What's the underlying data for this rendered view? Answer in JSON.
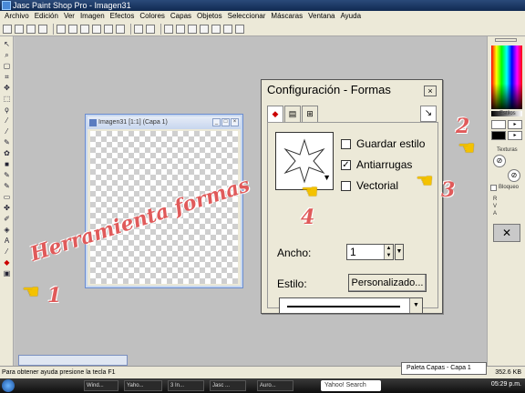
{
  "window": {
    "title": "Jasc Paint Shop Pro - Imagen31"
  },
  "menu": [
    "Archivo",
    "Edición",
    "Ver",
    "Imagen",
    "Efectos",
    "Colores",
    "Capas",
    "Objetos",
    "Seleccionar",
    "Máscaras",
    "Ventana",
    "Ayuda"
  ],
  "image_window": {
    "title": "Imagen31 [1:1] (Capa 1)"
  },
  "dialog": {
    "title": "Configuración - Formas",
    "close": "×",
    "guardar_estilo": "Guardar estilo",
    "antiarrugas": "Antiarrugas",
    "vectorial": "Vectorial",
    "ancho_label": "Ancho:",
    "ancho_value": "1",
    "estilo_label": "Estilo:",
    "personalizado": "Personalizado..."
  },
  "right_panel": {
    "estilos": "Estilos",
    "texturas": "Texturas",
    "bloqueo": "Bloqueo",
    "r": "R",
    "v": "V",
    "a": "A"
  },
  "annotation": {
    "text": "Herramienta formas",
    "n1": "1",
    "n2": "2",
    "n3": "3",
    "n4": "4"
  },
  "status": {
    "help": "Para obtener ayuda presione la tecla F1",
    "size": "352.6 KB"
  },
  "layers_tip": "Paleta Capas - Capa 1",
  "taskbar": {
    "items": [
      "Wind...",
      "Yaho...",
      "3 In...",
      "Jasc ...",
      "Auro..."
    ],
    "search": "Yahoo! Search",
    "clock": "05:29 p.m."
  }
}
